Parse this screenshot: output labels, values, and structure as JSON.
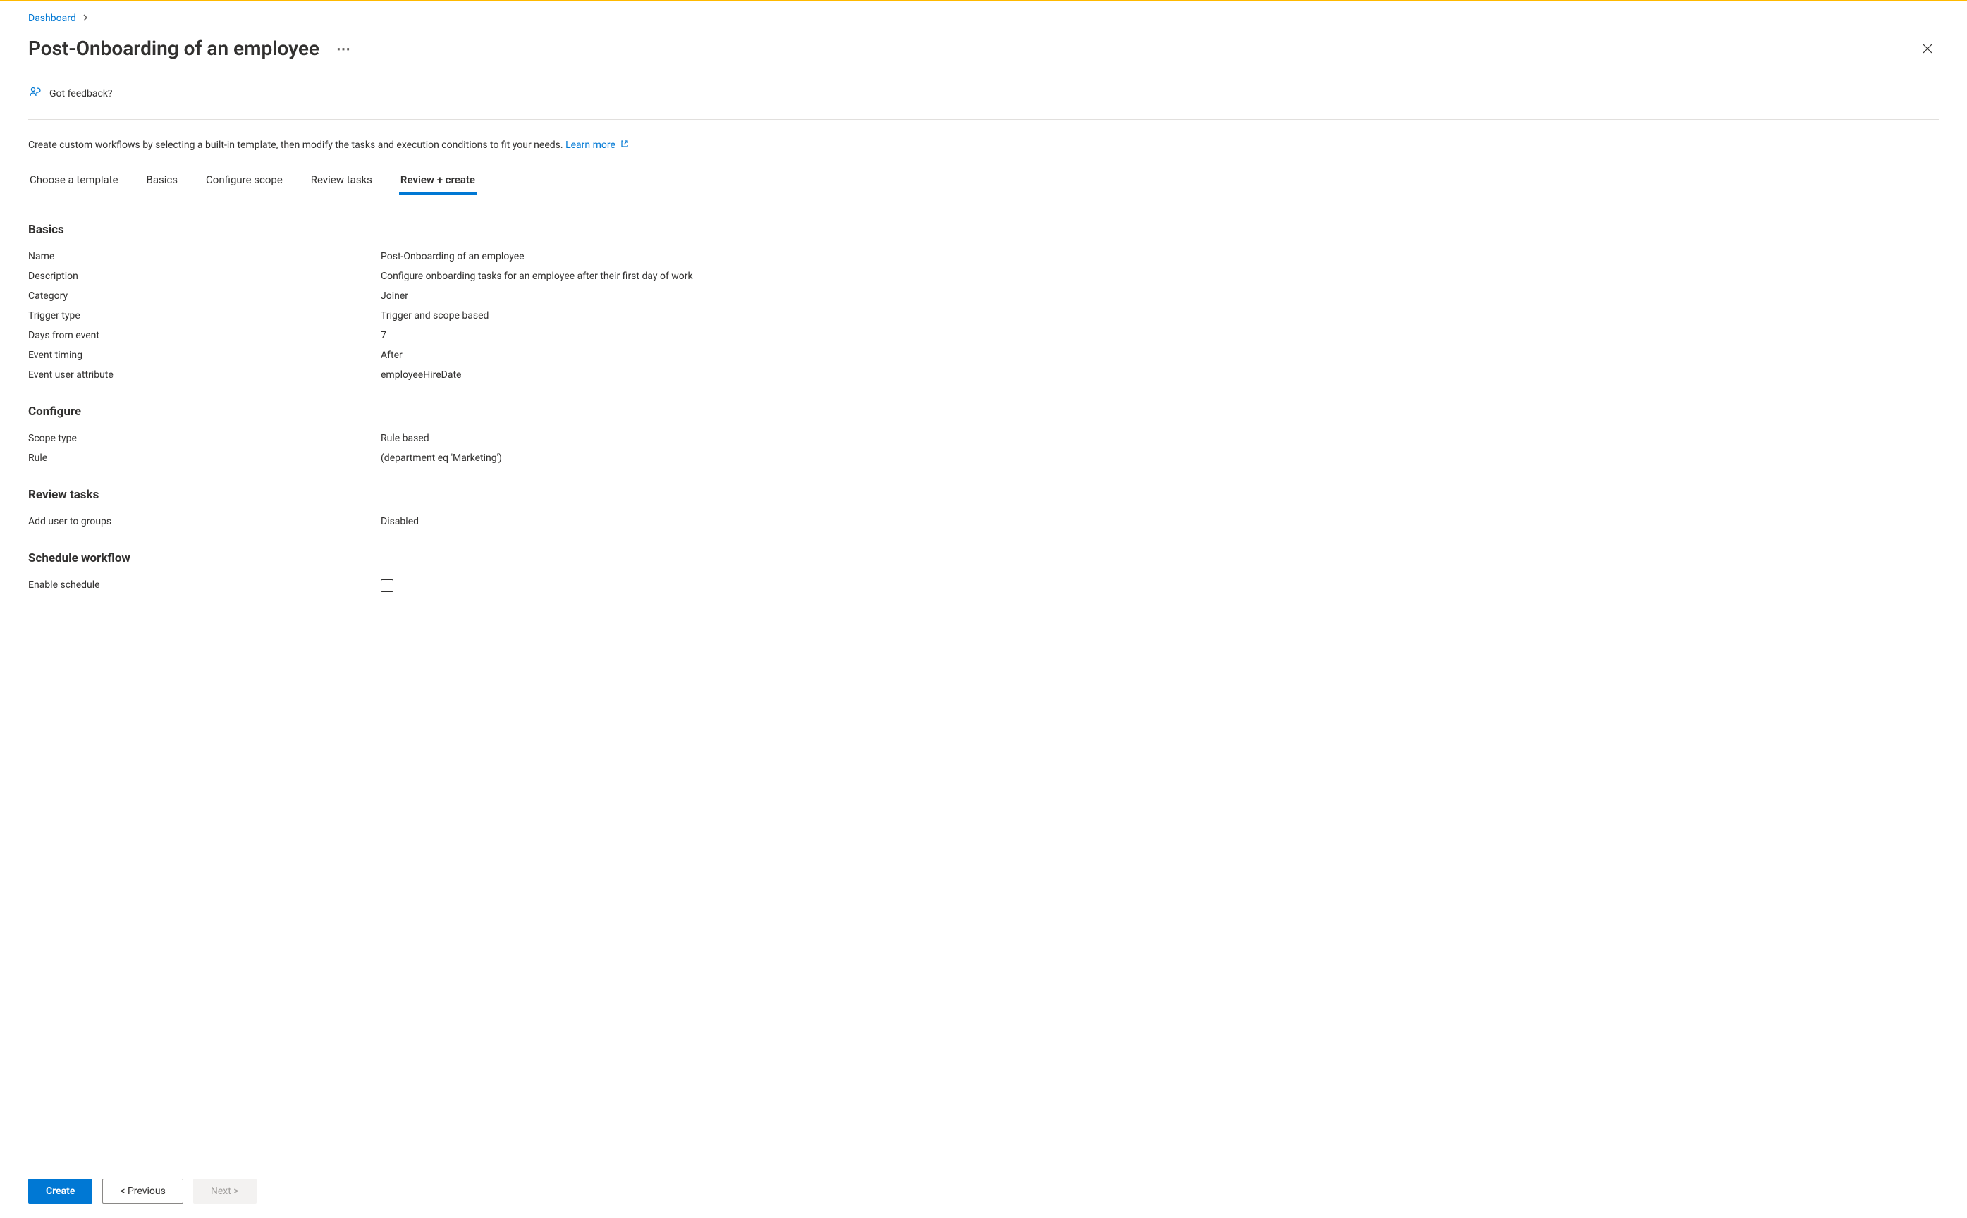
{
  "breadcrumb": {
    "link": "Dashboard"
  },
  "page": {
    "title": "Post-Onboarding of an employee"
  },
  "feedback": {
    "label": "Got feedback?"
  },
  "intro": {
    "text": "Create custom workflows by selecting a built-in template, then modify the tasks and execution conditions to fit your needs. ",
    "learn_more": "Learn more"
  },
  "tabs": {
    "t0": "Choose a template",
    "t1": "Basics",
    "t2": "Configure scope",
    "t3": "Review tasks",
    "t4": "Review + create"
  },
  "sections": {
    "basics": {
      "heading": "Basics",
      "name_label": "Name",
      "name_value": "Post-Onboarding of an employee",
      "description_label": "Description",
      "description_value": "Configure onboarding tasks for an employee after their first day of work",
      "category_label": "Category",
      "category_value": "Joiner",
      "trigger_type_label": "Trigger type",
      "trigger_type_value": "Trigger and scope based",
      "days_from_event_label": "Days from event",
      "days_from_event_value": "7",
      "event_timing_label": "Event timing",
      "event_timing_value": "After",
      "event_user_attr_label": "Event user attribute",
      "event_user_attr_value": "employeeHireDate"
    },
    "configure": {
      "heading": "Configure",
      "scope_type_label": "Scope type",
      "scope_type_value": "Rule based",
      "rule_label": "Rule",
      "rule_value": "(department eq 'Marketing')"
    },
    "review_tasks": {
      "heading": "Review tasks",
      "add_user_label": "Add user to groups",
      "add_user_value": "Disabled"
    },
    "schedule": {
      "heading": "Schedule workflow",
      "enable_label": "Enable schedule"
    }
  },
  "footer": {
    "create": "Create",
    "previous": "<  Previous",
    "next": "Next  >"
  }
}
